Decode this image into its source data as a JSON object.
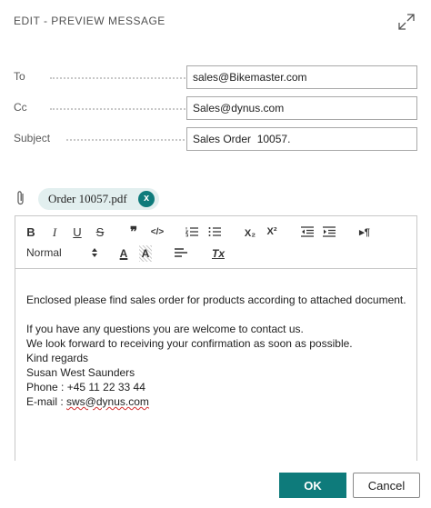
{
  "dialog": {
    "title": "EDIT - PREVIEW MESSAGE",
    "expand_icon": "expand-diagonal-icon"
  },
  "fields": {
    "to": {
      "label": "To",
      "value": "sales@Bikemaster.com"
    },
    "cc": {
      "label": "Cc",
      "value": "Sales@dynus.com"
    },
    "subject": {
      "label": "Subject",
      "value": "Sales Order  10057."
    }
  },
  "attachment": {
    "icon": "paperclip-icon",
    "file_name": "Order 10057.pdf",
    "remove_glyph": "x"
  },
  "toolbar": {
    "bold": "B",
    "italic": "I",
    "underline": "U",
    "strike": "S",
    "blockquote": "❞",
    "code": "</>",
    "ordered_list_icon": "ordered-list-icon",
    "bullet_list_icon": "bullet-list-icon",
    "subscript": "X₂",
    "superscript": "X²",
    "outdent_icon": "outdent-icon",
    "indent_icon": "indent-icon",
    "direction": "▸¶",
    "format_value": "Normal",
    "text_color": "A",
    "background_color": "A",
    "align_icon": "align-left-icon",
    "clear": "Tx"
  },
  "message": {
    "lines": [
      "Enclosed please find sales order for products according to attached document.",
      "",
      "If you have any questions you are welcome to contact us.",
      "We look forward to receiving your confirmation as soon as possible.",
      "Kind regards",
      "Susan West Saunders",
      "Phone : +45 11 22 33 44"
    ],
    "email_prefix": "E-mail : ",
    "email_address": "sws@dynus.com"
  },
  "buttons": {
    "ok": "OK",
    "cancel": "Cancel"
  },
  "colors": {
    "accent": "#0e7b7b",
    "chip_background": "#e2efef",
    "spellcheck": "#d32f2f"
  }
}
